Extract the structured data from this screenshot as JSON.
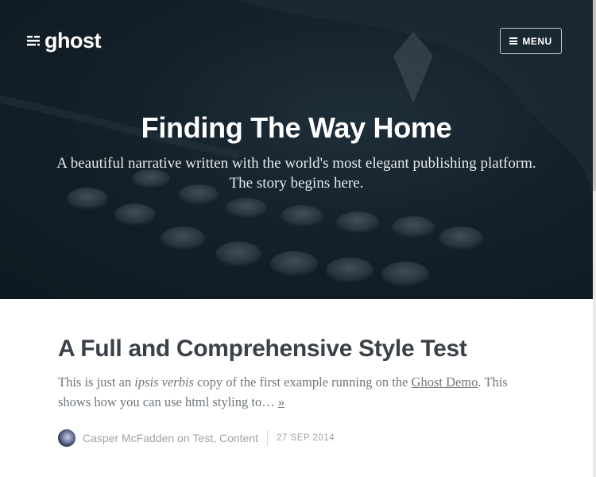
{
  "header": {
    "logo_text": "ghost",
    "menu_label": "MENU",
    "title": "Finding The Way Home",
    "description": "A beautiful narrative written with the world's most elegant publishing platform. The story begins here."
  },
  "post": {
    "title": "A Full and Comprehensive Style Test",
    "excerpt_pre": "This is just an ",
    "excerpt_em": "ipsis verbis",
    "excerpt_mid": " copy of the first example running on the ",
    "excerpt_link": "Ghost Demo",
    "excerpt_post": ". This shows how you can use html styling to… ",
    "read_more": "»",
    "author": "Casper McFadden",
    "on_word": " on ",
    "tags": "Test, Content",
    "date": "27 SEP 2014"
  },
  "colors": {
    "hero_overlay": "#1c2a33",
    "title_text": "#3b4148",
    "body_text": "#6f777d",
    "meta_text": "#9ea4a8"
  },
  "icons": {
    "logo": "ghost-logo-icon",
    "menu": "hamburger-icon"
  }
}
